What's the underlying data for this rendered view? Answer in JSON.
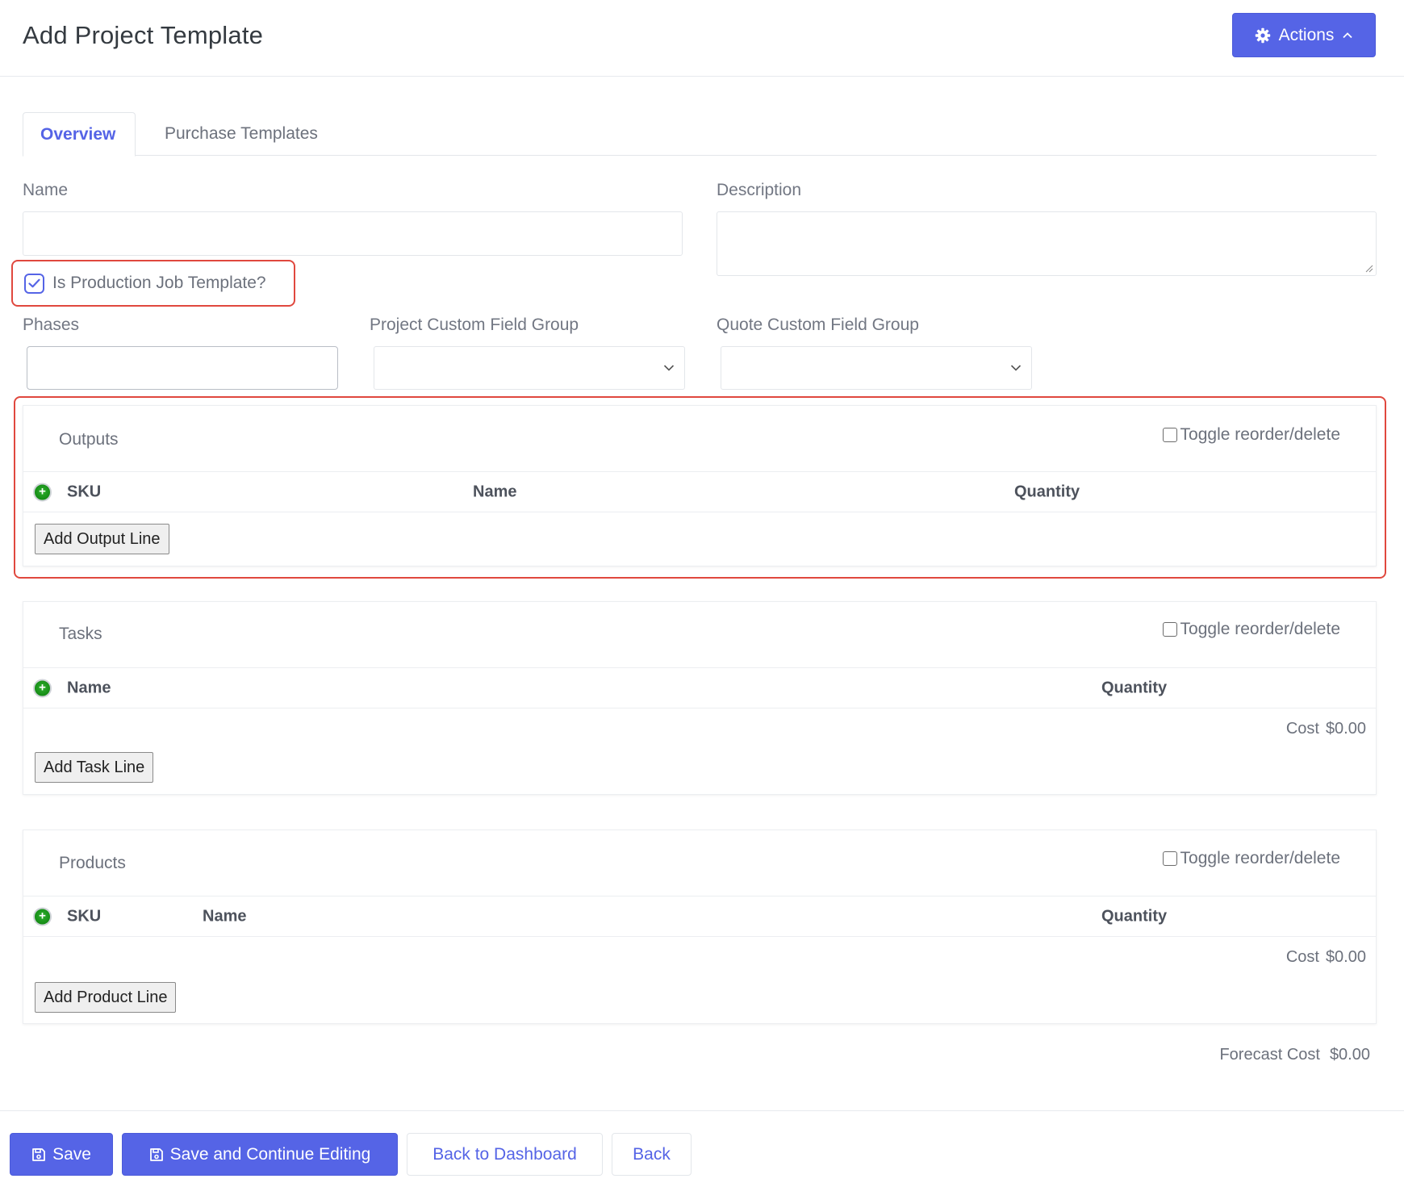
{
  "header": {
    "title": "Add Project Template",
    "actions_label": "Actions",
    "actions_icon": "gear-icon",
    "actions_chevron": "chevron-up-icon"
  },
  "tabs": [
    {
      "label": "Overview",
      "active": true
    },
    {
      "label": "Purchase Templates",
      "active": false
    }
  ],
  "form": {
    "name_label": "Name",
    "name_value": "",
    "description_label": "Description",
    "description_value": "",
    "production_label": "Is Production Job Template?",
    "production_checked": true,
    "phases_label": "Phases",
    "phases_value": "",
    "project_cfg_label": "Project Custom Field Group",
    "project_cfg_value": "",
    "quote_cfg_label": "Quote Custom Field Group",
    "quote_cfg_value": ""
  },
  "outputs": {
    "title": "Outputs",
    "toggle_label": "Toggle reorder/delete",
    "columns": [
      "SKU",
      "Name",
      "Quantity"
    ],
    "add_label": "Add Output Line"
  },
  "tasks": {
    "title": "Tasks",
    "toggle_label": "Toggle reorder/delete",
    "columns": [
      "Name",
      "Quantity"
    ],
    "cost_label": "Cost",
    "cost_value": "$0.00",
    "add_label": "Add Task Line"
  },
  "products": {
    "title": "Products",
    "toggle_label": "Toggle reorder/delete",
    "columns": [
      "SKU",
      "Name",
      "Quantity"
    ],
    "cost_label": "Cost",
    "cost_value": "$0.00",
    "add_label": "Add Product Line"
  },
  "forecast": {
    "label": "Forecast Cost",
    "value": "$0.00"
  },
  "footer": {
    "save_label": "Save",
    "save_continue_label": "Save and Continue Editing",
    "back_dashboard_label": "Back to Dashboard",
    "back_label": "Back"
  },
  "colors": {
    "accent": "#5564e6",
    "highlight": "#e0483e",
    "add_green": "#1a9a1a"
  }
}
